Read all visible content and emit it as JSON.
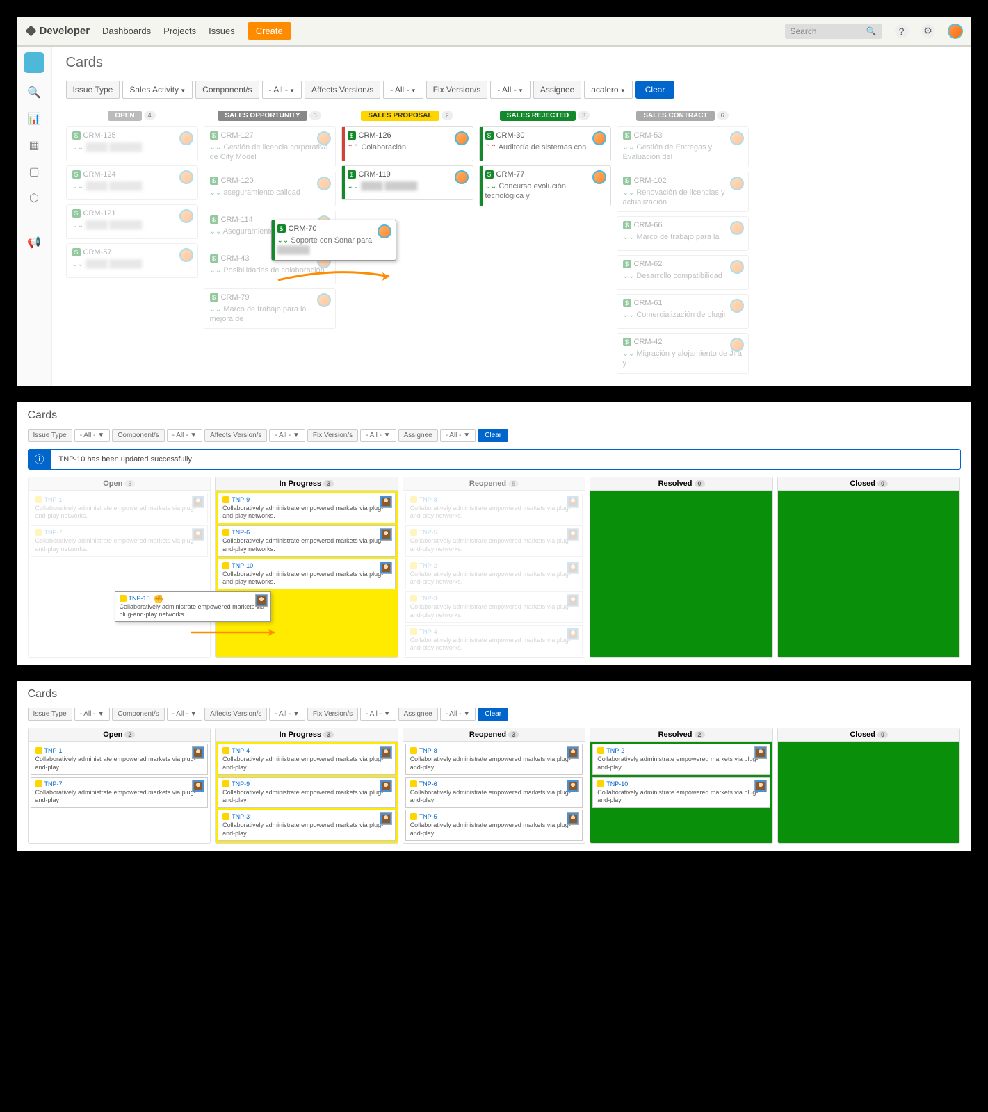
{
  "panel1": {
    "header": {
      "logo": "Developer",
      "nav": [
        "Dashboards",
        "Projects",
        "Issues"
      ],
      "create": "Create",
      "search_ph": "Search"
    },
    "title": "Cards",
    "filters": {
      "issue_type": "Issue Type",
      "issue_type_v": "Sales Activity",
      "components": "Component/s",
      "components_v": "- All -",
      "affects": "Affects Version/s",
      "affects_v": "- All -",
      "fix": "Fix Version/s",
      "fix_v": "- All -",
      "assignee": "Assignee",
      "assignee_v": "acalero",
      "clear": "Clear"
    },
    "cols": {
      "open": {
        "label": "OPEN",
        "count": "4",
        "cards": [
          {
            "id": "CRM-125",
            "desc": ""
          },
          {
            "id": "CRM-124",
            "desc": ""
          },
          {
            "id": "CRM-121",
            "desc": ""
          },
          {
            "id": "CRM-57",
            "desc": ""
          }
        ]
      },
      "so": {
        "label": "SALES OPPORTUNITY",
        "count": "5",
        "cards": [
          {
            "id": "CRM-127",
            "desc": "Gestión de licencia corporativa de City Model"
          },
          {
            "id": "CRM-120",
            "desc": "aseguramiento calidad"
          },
          {
            "id": "CRM-114",
            "desc": "Aseguramiento y g"
          },
          {
            "id": "CRM-43",
            "desc": "Posibilidades de colaboración"
          },
          {
            "id": "CRM-79",
            "desc": "Marco de trabajo para la mejora de"
          }
        ]
      },
      "sp": {
        "label": "SALES PROPOSAL",
        "count": "2",
        "cards": [
          {
            "id": "CRM-126",
            "desc": "Colaboración",
            "edge": "red",
            "chev": "r"
          },
          {
            "id": "CRM-119",
            "desc": "",
            "edge": "green",
            "chev": "g"
          }
        ]
      },
      "sr": {
        "label": "SALES REJECTED",
        "count": "3",
        "cards": [
          {
            "id": "CRM-30",
            "desc": "Auditoría de sistemas con",
            "edge": "green",
            "chev": "r"
          },
          {
            "id": "CRM-77",
            "desc": "Concurso evolución tecnológica y",
            "edge": "green",
            "chev": "g"
          }
        ]
      },
      "sc": {
        "label": "SALES CONTRACT",
        "count": "6",
        "cards": [
          {
            "id": "CRM-53",
            "desc": "Gestión de Entregas y Evaluación del"
          },
          {
            "id": "CRM-102",
            "desc": "Renovación de licencias y actualización"
          },
          {
            "id": "CRM-66",
            "desc": "Marco de trabajo para la"
          },
          {
            "id": "CRM-62",
            "desc": "Desarrollo compatibilidad"
          },
          {
            "id": "CRM-61",
            "desc": "Comercialización de plugin"
          },
          {
            "id": "CRM-42",
            "desc": "Migración y alojamiento de Jira y"
          }
        ]
      }
    },
    "float": {
      "id": "CRM-70",
      "desc": "Soporte con Sonar para"
    }
  },
  "panel2": {
    "title": "Cards",
    "filters": {
      "issue_type": "Issue Type",
      "all": "- All -",
      "components": "Component/s",
      "affects": "Affects Version/s",
      "fix": "Fix Version/s",
      "assignee": "Assignee",
      "clear": "Clear"
    },
    "banner": "TNP-10 has been updated successfully",
    "cols": {
      "open": {
        "label": "Open",
        "count": "3",
        "cards": [
          {
            "id": "TNP-1"
          },
          {
            "id": "TNP-7"
          }
        ]
      },
      "inprog": {
        "label": "In Progress",
        "count": "3",
        "cards": [
          {
            "id": "TNP-9"
          },
          {
            "id": "TNP-6"
          },
          {
            "id": "TNP-10"
          }
        ]
      },
      "reopen": {
        "label": "Reopened",
        "count": "5",
        "cards": [
          {
            "id": "TNP-8"
          },
          {
            "id": "TNP-5"
          },
          {
            "id": "TNP-2"
          },
          {
            "id": "TNP-3"
          },
          {
            "id": "TNP-4"
          }
        ]
      },
      "resolved": {
        "label": "Resolved",
        "count": "0"
      },
      "closed": {
        "label": "Closed",
        "count": "0"
      }
    },
    "float": {
      "id": "TNP-10"
    },
    "desc": "Collaboratively administrate empowered markets via plug-and-play networks."
  },
  "panel3": {
    "title": "Cards",
    "cols": {
      "open": {
        "label": "Open",
        "count": "2",
        "cards": [
          {
            "id": "TNP-1"
          },
          {
            "id": "TNP-7"
          }
        ]
      },
      "inprog": {
        "label": "In Progress",
        "count": "3",
        "cards": [
          {
            "id": "TNP-4"
          },
          {
            "id": "TNP-9"
          },
          {
            "id": "TNP-3"
          }
        ]
      },
      "reopen": {
        "label": "Reopened",
        "count": "3",
        "cards": [
          {
            "id": "TNP-8"
          },
          {
            "id": "TNP-6"
          },
          {
            "id": "TNP-5"
          }
        ]
      },
      "resolved": {
        "label": "Resolved",
        "count": "2",
        "cards": [
          {
            "id": "TNP-2"
          },
          {
            "id": "TNP-10"
          }
        ]
      },
      "closed": {
        "label": "Closed",
        "count": "0"
      }
    },
    "desc": "Collaboratively administrate empowered markets via plug-and-play"
  }
}
